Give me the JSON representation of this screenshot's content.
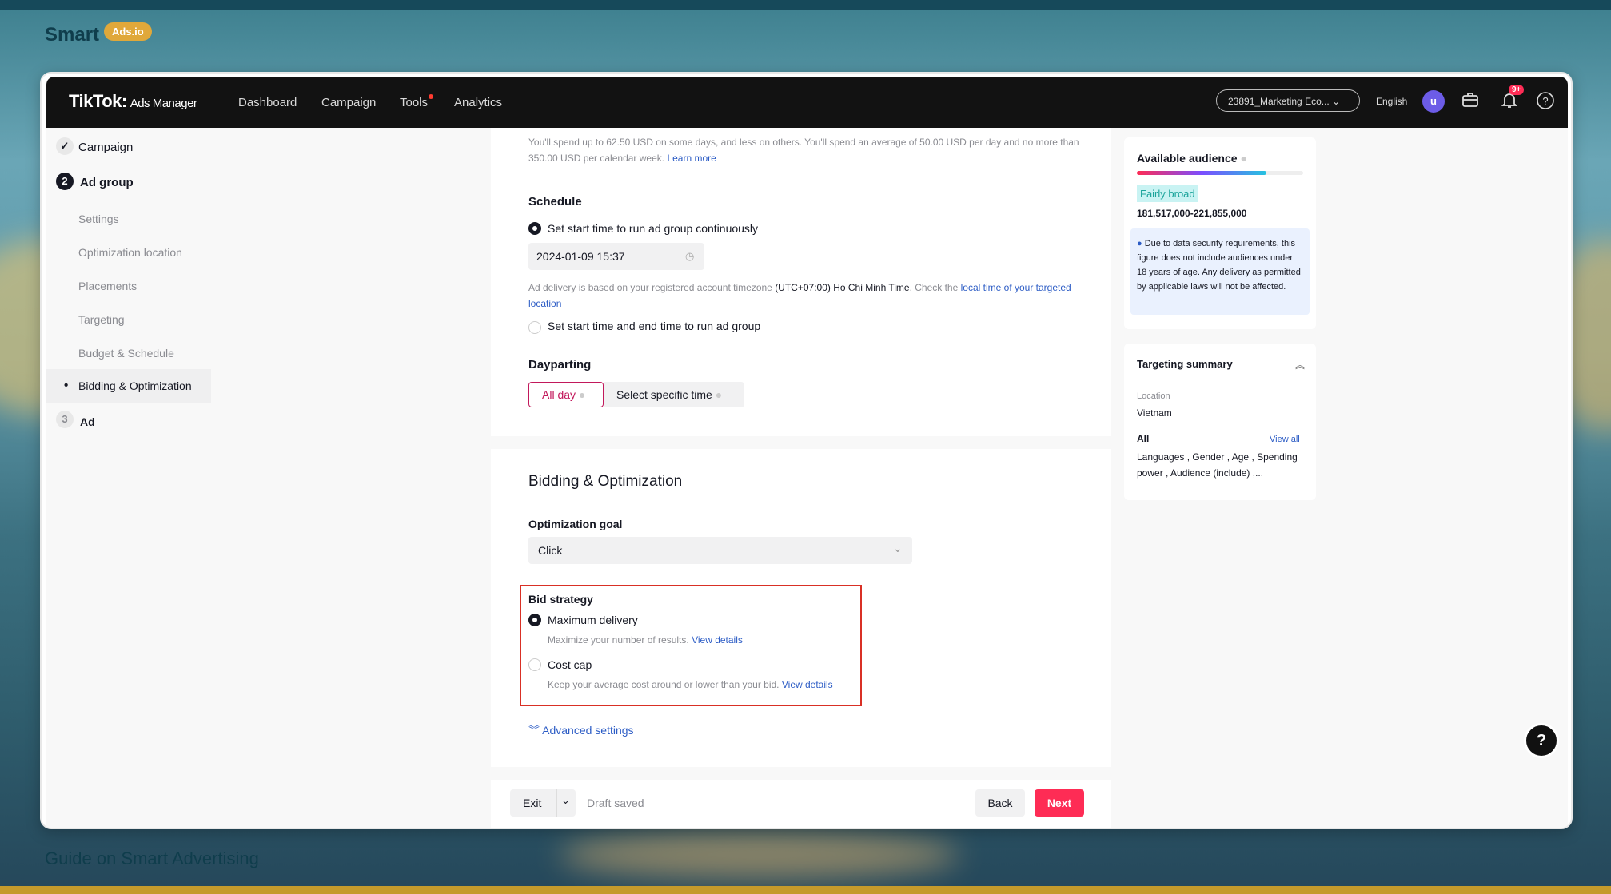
{
  "branding": {
    "name": "Smart",
    "badge": "Ads.io",
    "footer": "Guide on Smart Advertising"
  },
  "nav": {
    "logo": "TikTok",
    "logo_sub": "Ads Manager",
    "items": [
      "Dashboard",
      "Campaign",
      "Tools",
      "Analytics"
    ],
    "account": "23891_Marketing Eco...",
    "language": "English",
    "avatar": "u",
    "notif_badge": "9+"
  },
  "sidebar": {
    "campaign": "Campaign",
    "adgroup_num": "2",
    "adgroup": "Ad group",
    "subitems": [
      "Settings",
      "Optimization location",
      "Placements",
      "Targeting",
      "Budget & Schedule",
      "Bidding & Optimization"
    ],
    "ad_num": "3",
    "ad": "Ad"
  },
  "budget_note": {
    "text": "You'll spend up to 62.50 USD on some days, and less on others. You'll spend an average of 50.00 USD per day and no more than 350.00 USD per calendar week.",
    "link": "Learn more"
  },
  "schedule": {
    "title": "Schedule",
    "option1": "Set start time to run ad group continuously",
    "datetime": "2024-01-09 15:37",
    "tz_note_a": "Ad delivery is based on your registered account timezone",
    "tz_value": "(UTC+07:00) Ho Chi Minh Time",
    "tz_note_b": ". Check the",
    "tz_link": "local time of your targeted location",
    "option2": "Set start time and end time to run ad group"
  },
  "dayparting": {
    "title": "Dayparting",
    "all_day": "All day",
    "specific": "Select specific time"
  },
  "bidding": {
    "title": "Bidding & Optimization",
    "goal_label": "Optimization goal",
    "goal_value": "Click",
    "strategy_label": "Bid strategy",
    "max_label": "Maximum delivery",
    "max_desc": "Maximize your number of results.",
    "max_link": "View details",
    "cost_label": "Cost cap",
    "cost_desc": "Keep your average cost around or lower than your bid.",
    "cost_link": "View details",
    "advanced": "Advanced settings"
  },
  "footer_bar": {
    "exit": "Exit",
    "draft": "Draft saved",
    "back": "Back",
    "next": "Next"
  },
  "audience": {
    "title": "Available audience",
    "level": "Fairly broad",
    "meter_fraction": 0.78,
    "range": "181,517,000-221,855,000",
    "note": "Due to data security requirements, this figure does not include audiences under 18 years of age. Any delivery as permitted by applicable laws will not be affected."
  },
  "targeting_summary": {
    "title": "Targeting summary",
    "location_label": "Location",
    "location_value": "Vietnam",
    "all_label": "All",
    "view_all": "View all",
    "all_value": "Languages , Gender , Age , Spending power , Audience (include) ,..."
  },
  "colors": {
    "accent": "#fe2c55",
    "link": "#2c5cc5",
    "highlight_box": "#d93025",
    "audience_tag_bg": "#c9f3f3"
  }
}
